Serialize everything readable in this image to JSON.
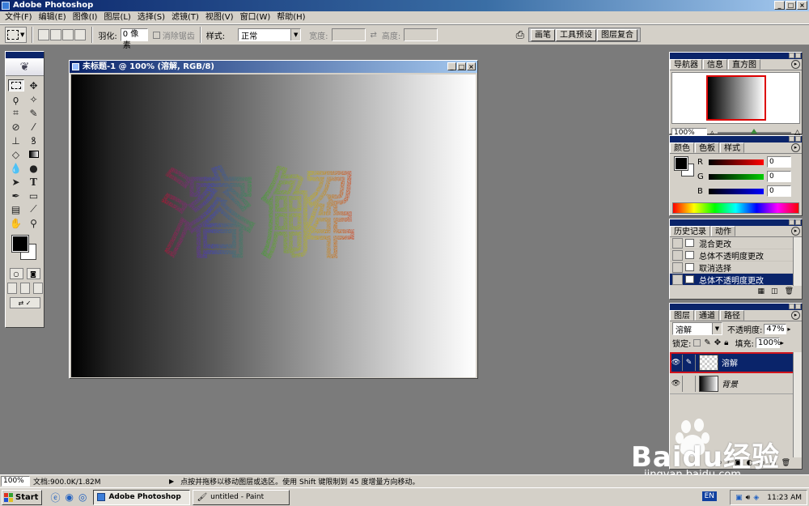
{
  "window": {
    "title": "Adobe Photoshop"
  },
  "menu": [
    "文件(F)",
    "编辑(E)",
    "图像(I)",
    "图层(L)",
    "选择(S)",
    "滤镜(T)",
    "视图(V)",
    "窗口(W)",
    "帮助(H)"
  ],
  "options": {
    "feather_label": "羽化:",
    "feather_value": "0 像素",
    "antialias_label": "消除锯齿",
    "style_label": "样式:",
    "style_value": "正常",
    "width_label": "宽度:",
    "height_label": "高度:",
    "palette_well": [
      "画笔",
      "工具预设",
      "图层复合"
    ]
  },
  "document": {
    "title": "未标题-1 @ 100% (溶解, RGB/8)",
    "text": "溶解"
  },
  "navigator": {
    "tabs": [
      "导航器",
      "信息",
      "直方图"
    ],
    "zoom": "100%"
  },
  "color": {
    "tabs": [
      "颜色",
      "色板",
      "样式"
    ],
    "channels": [
      {
        "label": "R",
        "value": "0"
      },
      {
        "label": "G",
        "value": "0"
      },
      {
        "label": "B",
        "value": "0"
      }
    ]
  },
  "history": {
    "tabs": [
      "历史记录",
      "动作"
    ],
    "items": [
      "混合更改",
      "总体不透明度更改",
      "取消选择",
      "总体不透明度更改"
    ]
  },
  "layers": {
    "tabs": [
      "图层",
      "通道",
      "路径"
    ],
    "blend_mode": "溶解",
    "opacity_label": "不透明度:",
    "opacity": "47%",
    "lock_label": "锁定:",
    "fill_label": "填充:",
    "fill": "100%",
    "items": [
      {
        "name": "溶解"
      },
      {
        "name": "背景"
      }
    ]
  },
  "status": {
    "zoom": "100%",
    "doc_info": "文档:900.0K/1.82M",
    "hint": "点按并拖移以移动图层或选区。使用 Shift 键限制到 45 度增量方向移动。"
  },
  "taskbar": {
    "start": "Start",
    "tasks": [
      "Adobe Photoshop",
      "untitled - Paint"
    ],
    "lang": "EN",
    "time": "11:23 AM"
  },
  "watermark": {
    "brand": "Baidu经验",
    "url": "jingyan.baidu.com"
  },
  "colors": {
    "titlebar": "#0a246a",
    "selection": "#0a246a",
    "highlight_outline": "#d0141c",
    "chrome": "#d4d0c8"
  }
}
